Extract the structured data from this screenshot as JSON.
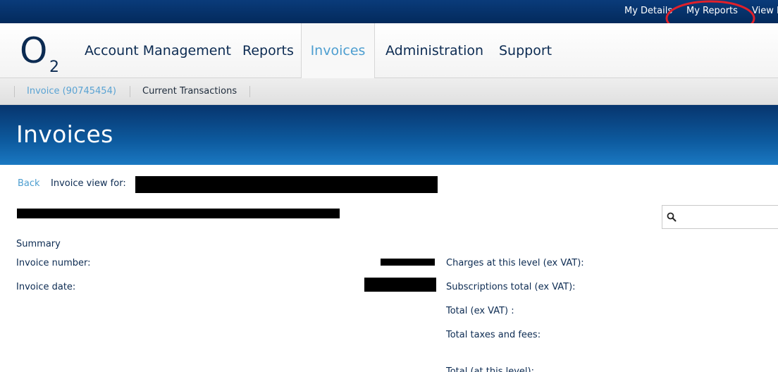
{
  "top_bar": {
    "links": [
      "My Details",
      "My Reports",
      "View D"
    ],
    "highlight_color": "#e0202a"
  },
  "brand": {
    "logo_text": "O",
    "logo_sub": "2",
    "color": "#0c2b52"
  },
  "main_nav": {
    "items": [
      "Account Management",
      "Reports",
      "Invoices",
      "Administration",
      "Support"
    ],
    "active": "Invoices"
  },
  "sub_nav": {
    "items": [
      "Invoice (90745454)",
      "Current Transactions"
    ]
  },
  "page": {
    "title": "Invoices"
  },
  "content": {
    "back_label": "Back",
    "view_for_label": "Invoice view for:",
    "search": {
      "placeholder": "",
      "icon": "search-icon"
    },
    "summary_label": "Summary",
    "left_fields": [
      "Invoice number:",
      "Invoice date:"
    ],
    "right_fields": [
      "Charges at this level (ex VAT):",
      "Subscriptions total (ex VAT):",
      "Total (ex VAT) :",
      "Total taxes and fees:",
      "Total (at this level):"
    ]
  }
}
